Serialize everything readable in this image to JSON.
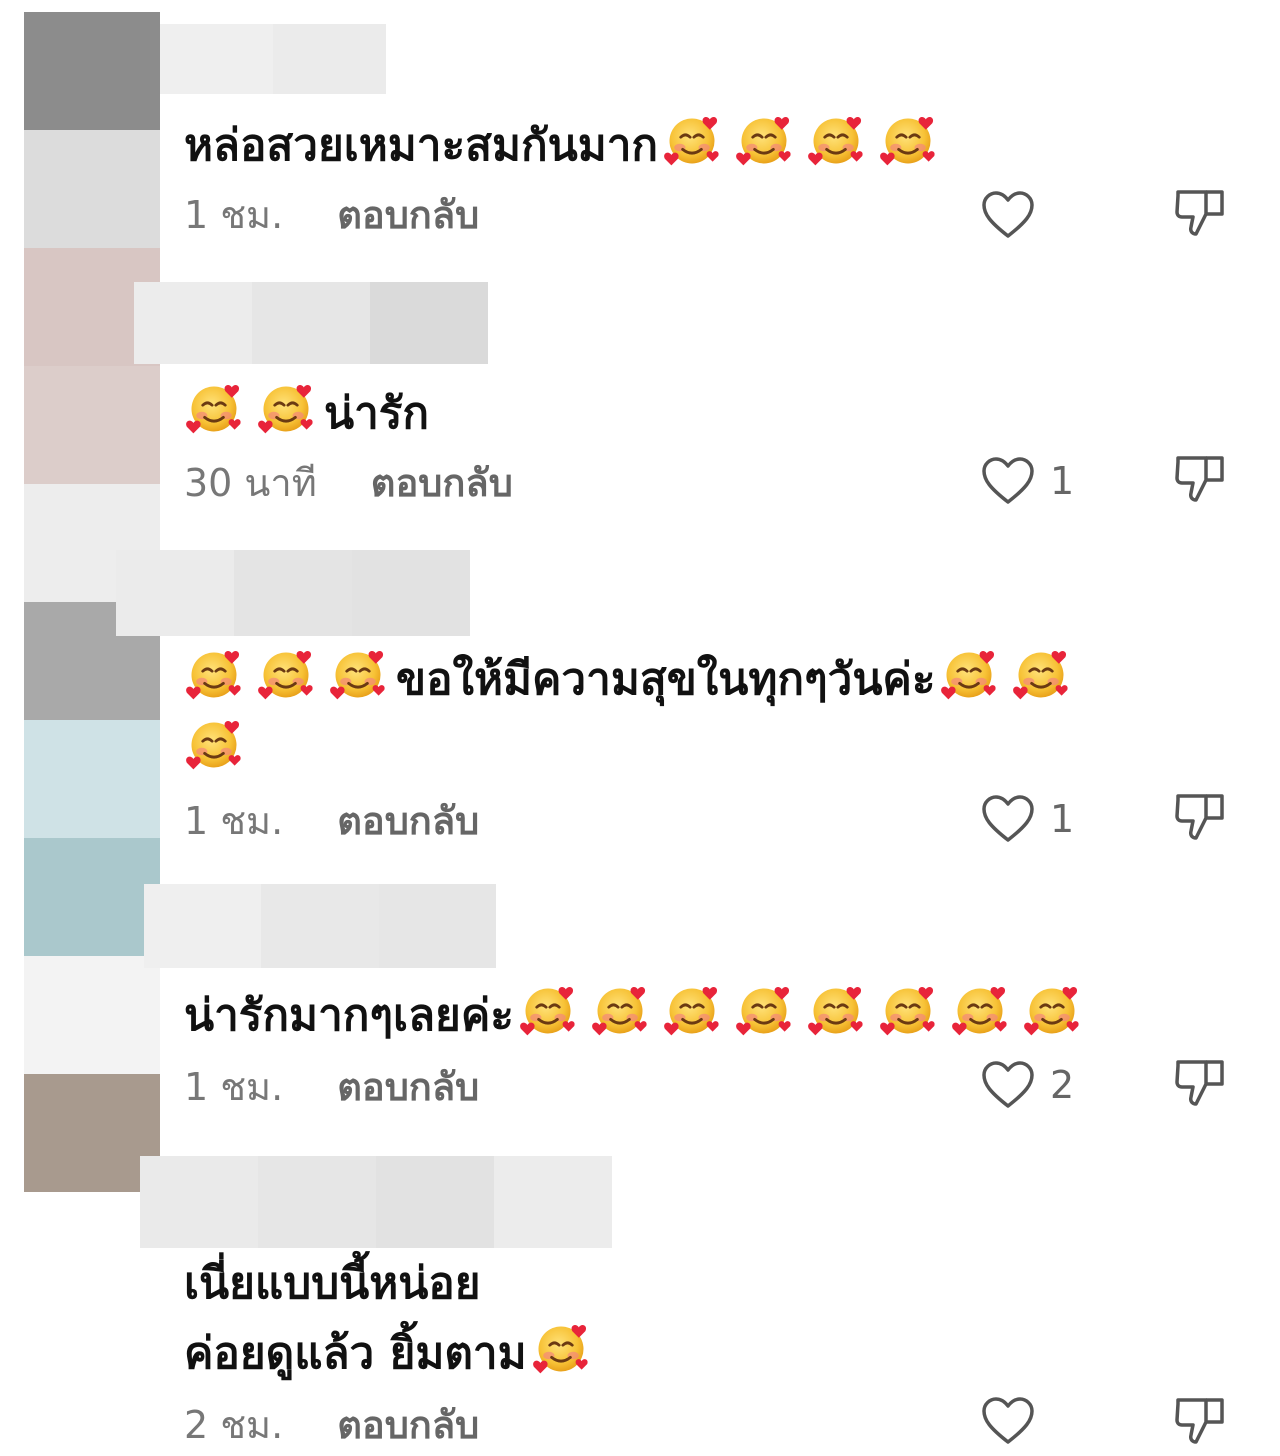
{
  "comments": [
    {
      "text": "หล่อสวยเหมาะสมกันมาก",
      "emoji_before": 0,
      "emoji_after": 4,
      "time": "1 ชม.",
      "reply": "ตอบกลับ",
      "likes": ""
    },
    {
      "text": "น่ารัก",
      "emoji_before": 2,
      "emoji_after": 0,
      "time": "30 นาที",
      "reply": "ตอบกลับ",
      "likes": "1"
    },
    {
      "text": "ขอให้มีความสุขในทุกๆวันค่ะ",
      "emoji_before": 3,
      "emoji_after": 2,
      "extra_line_emojis": 1,
      "time": "1 ชม.",
      "reply": "ตอบกลับ",
      "likes": "1"
    },
    {
      "text": "น่ารักมากๆเลยค่ะ",
      "emoji_before": 0,
      "emoji_after": 8,
      "time": "1 ชม.",
      "reply": "ตอบกลับ",
      "likes": "2"
    },
    {
      "text_line1": "เนี่ยแบบนี้หน่อย",
      "text_line2": "ค่อยดูแล้ว ยิ้มตาม",
      "emoji_after": 1,
      "time": "2 ชม.",
      "reply": "ตอบกลับ",
      "likes": ""
    }
  ],
  "icons": {
    "emoji": "smiling-face-with-hearts",
    "like": "heart-outline-icon",
    "dislike": "thumbs-down-outline-icon"
  },
  "colors": {
    "avatar_strip": [
      "#8c8c8c",
      "#dcdcdc",
      "#d8c6c3",
      "#dccdca",
      "#ededed",
      "#a9a9a9",
      "#cfe2e6",
      "#aac8cc",
      "#f3f3f3",
      "#a89a8e"
    ],
    "name_blur": "#e6e6e6",
    "meta_text": "#777777"
  }
}
